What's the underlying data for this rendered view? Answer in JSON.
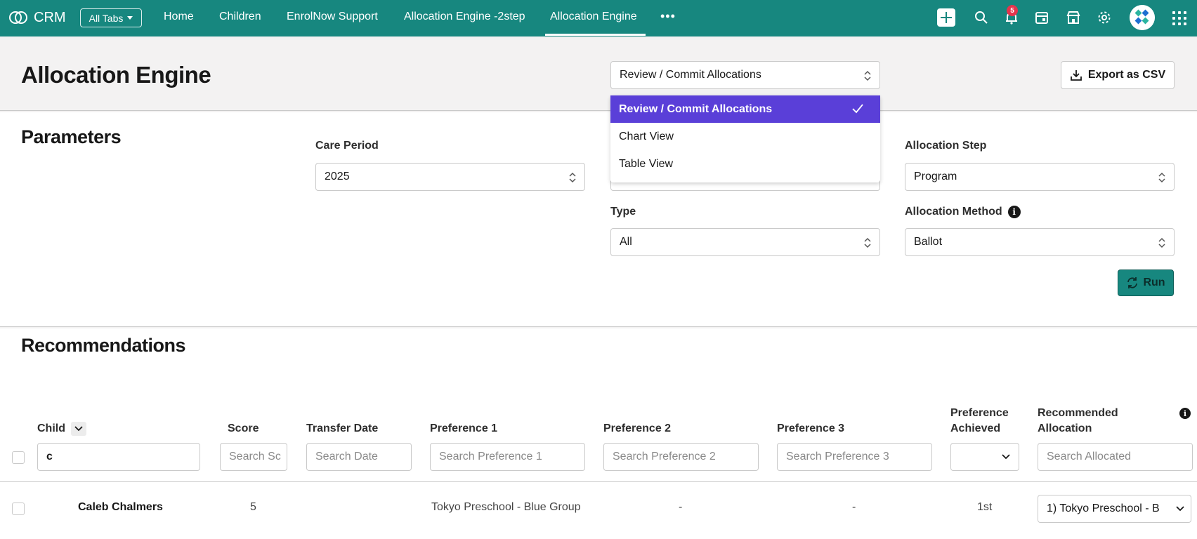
{
  "app": {
    "name": "CRM",
    "all_tabs": "All Tabs"
  },
  "nav": {
    "items": [
      {
        "label": "Home"
      },
      {
        "label": "Children"
      },
      {
        "label": "EnrolNow Support"
      },
      {
        "label": "Allocation Engine -2step"
      },
      {
        "label": "Allocation Engine"
      }
    ],
    "active": "Allocation Engine",
    "notifications_count": "5"
  },
  "header": {
    "title": "Allocation Engine",
    "view_select": "Review / Commit Allocations",
    "export_label": "Export as CSV"
  },
  "view_dropdown": {
    "options": [
      {
        "label": "Review / Commit Allocations",
        "selected": true
      },
      {
        "label": "Chart View",
        "selected": false
      },
      {
        "label": "Table View",
        "selected": false
      }
    ]
  },
  "parameters": {
    "title": "Parameters",
    "care_period": {
      "label": "Care Period",
      "value": "2025"
    },
    "allocation_step": {
      "label": "Allocation Step",
      "value": "Program"
    },
    "type": {
      "label": "Type",
      "value": "All"
    },
    "allocation_method": {
      "label": "Allocation Method",
      "value": "Ballot"
    },
    "run_label": "Run"
  },
  "recommendations": {
    "title": "Recommendations",
    "columns": {
      "child": "Child",
      "score": "Score",
      "transfer_date": "Transfer Date",
      "pref1": "Preference 1",
      "pref2": "Preference 2",
      "pref3": "Preference 3",
      "pref_achieved_1": "Preference",
      "pref_achieved_2": "Achieved",
      "recommended_1": "Recommended",
      "recommended_2": "Allocation"
    },
    "filters": {
      "child_value": "c",
      "score_placeholder": "Search Sc",
      "date_placeholder": "Search Date",
      "pref1_placeholder": "Search Preference 1",
      "pref2_placeholder": "Search Preference 2",
      "pref3_placeholder": "Search Preference 3",
      "allocated_placeholder": "Search Allocated"
    },
    "rows": [
      {
        "child": "Caleb Chalmers",
        "score": "5",
        "transfer_date": "",
        "pref1": "Tokyo Preschool - Blue Group",
        "pref2": "-",
        "pref3": "-",
        "achieved": "1st",
        "allocation": "1) Tokyo Preschool - B"
      }
    ]
  },
  "colors": {
    "brand": "#17877f",
    "selected": "#5a3fd8",
    "badge": "#e5344d"
  }
}
